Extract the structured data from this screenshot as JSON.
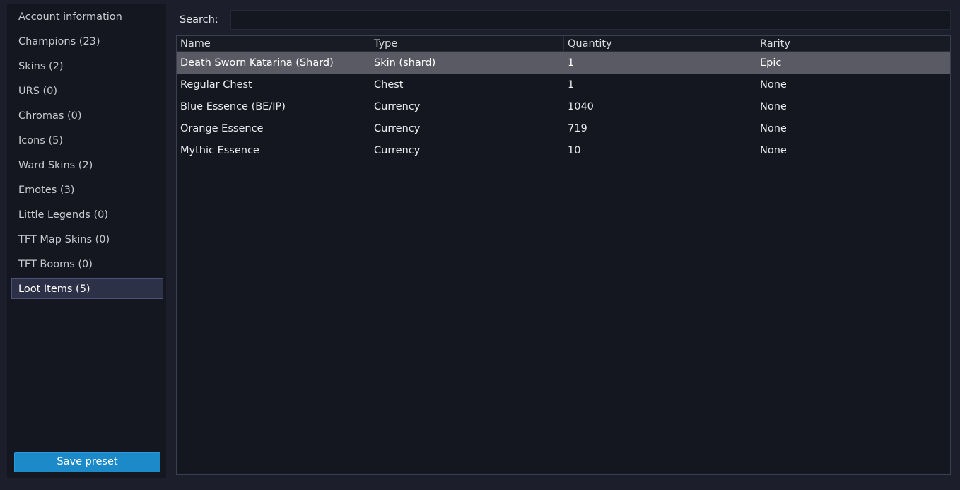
{
  "sidebar": {
    "items": [
      {
        "label": "Account information",
        "selected": false
      },
      {
        "label": "Champions (23)",
        "selected": false
      },
      {
        "label": "Skins (2)",
        "selected": false
      },
      {
        "label": "URS (0)",
        "selected": false
      },
      {
        "label": "Chromas (0)",
        "selected": false
      },
      {
        "label": "Icons (5)",
        "selected": false
      },
      {
        "label": "Ward Skins (2)",
        "selected": false
      },
      {
        "label": "Emotes (3)",
        "selected": false
      },
      {
        "label": "Little Legends (0)",
        "selected": false
      },
      {
        "label": "TFT Map Skins (0)",
        "selected": false
      },
      {
        "label": "TFT Booms (0)",
        "selected": false
      },
      {
        "label": "Loot Items (5)",
        "selected": true
      }
    ],
    "save_label": "Save preset"
  },
  "search": {
    "label": "Search:",
    "value": "",
    "placeholder": ""
  },
  "table": {
    "columns": [
      "Name",
      "Type",
      "Quantity",
      "Rarity"
    ],
    "rows": [
      {
        "name": "Death Sworn Katarina (Shard)",
        "type": "Skin (shard)",
        "quantity": "1",
        "rarity": "Epic",
        "selected": true
      },
      {
        "name": "Regular Chest",
        "type": "Chest",
        "quantity": "1",
        "rarity": "None",
        "selected": false
      },
      {
        "name": "Blue Essence (BE/IP)",
        "type": "Currency",
        "quantity": "1040",
        "rarity": "None",
        "selected": false
      },
      {
        "name": "Orange Essence",
        "type": "Currency",
        "quantity": "719",
        "rarity": "None",
        "selected": false
      },
      {
        "name": "Mythic Essence",
        "type": "Currency",
        "quantity": "10",
        "rarity": "None",
        "selected": false
      }
    ]
  },
  "colors": {
    "background": "#1c1f2b",
    "panel": "#14171f",
    "accent": "#1c8ac9",
    "selected_row": "#595a63",
    "selected_sidebar": "#2d3147"
  }
}
